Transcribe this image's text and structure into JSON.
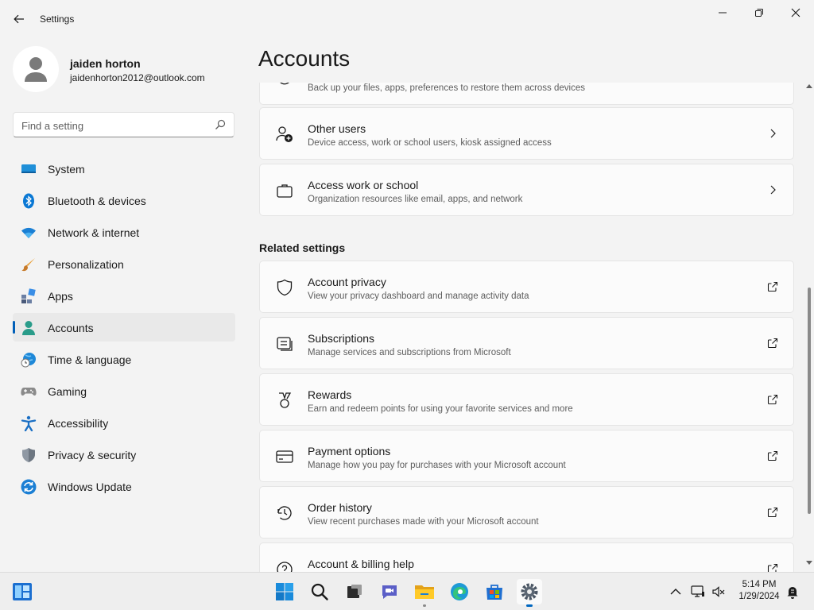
{
  "window": {
    "title": "Settings"
  },
  "profile": {
    "name": "jaiden horton",
    "email": "jaidenhorton2012@outlook.com"
  },
  "search": {
    "placeholder": "Find a setting"
  },
  "nav": {
    "items": [
      {
        "label": "System",
        "icon": "system-icon"
      },
      {
        "label": "Bluetooth & devices",
        "icon": "bluetooth-icon"
      },
      {
        "label": "Network & internet",
        "icon": "wifi-icon"
      },
      {
        "label": "Personalization",
        "icon": "brush-icon"
      },
      {
        "label": "Apps",
        "icon": "apps-icon"
      },
      {
        "label": "Accounts",
        "icon": "person-icon",
        "selected": true
      },
      {
        "label": "Time & language",
        "icon": "globe-clock-icon"
      },
      {
        "label": "Gaming",
        "icon": "gamepad-icon"
      },
      {
        "label": "Accessibility",
        "icon": "accessibility-icon"
      },
      {
        "label": "Privacy & security",
        "icon": "shield-icon"
      },
      {
        "label": "Windows Update",
        "icon": "update-icon"
      }
    ]
  },
  "main": {
    "title": "Accounts",
    "cards": [
      {
        "title": "",
        "subtitle": "Back up your files, apps, preferences to restore them across devices",
        "icon": "backup-icon",
        "action": "chevron-right-icon"
      },
      {
        "title": "Other users",
        "subtitle": "Device access, work or school users, kiosk assigned access",
        "icon": "person-add-icon",
        "action": "chevron-right-icon"
      },
      {
        "title": "Access work or school",
        "subtitle": "Organization resources like email, apps, and network",
        "icon": "briefcase-icon",
        "action": "chevron-right-icon"
      }
    ],
    "related_title": "Related settings",
    "related": [
      {
        "title": "Account privacy",
        "subtitle": "View your privacy dashboard and manage activity data",
        "icon": "shield-outline-icon",
        "action": "open-external-icon"
      },
      {
        "title": "Subscriptions",
        "subtitle": "Manage services and subscriptions from Microsoft",
        "icon": "subscriptions-icon",
        "action": "open-external-icon"
      },
      {
        "title": "Rewards",
        "subtitle": "Earn and redeem points for using your favorite services and more",
        "icon": "medal-icon",
        "action": "open-external-icon"
      },
      {
        "title": "Payment options",
        "subtitle": "Manage how you pay for purchases with your Microsoft account",
        "icon": "credit-card-icon",
        "action": "open-external-icon"
      },
      {
        "title": "Order history",
        "subtitle": "View recent purchases made with your Microsoft account",
        "icon": "history-icon",
        "action": "open-external-icon"
      },
      {
        "title": "Account & billing help",
        "subtitle": "",
        "icon": "help-icon",
        "action": "open-external-icon"
      }
    ]
  },
  "taskbar": {
    "apps": [
      "widgets-icon",
      "start-icon",
      "search-icon",
      "task-view-icon",
      "chat-icon",
      "file-explorer-icon",
      "edge-icon",
      "store-icon",
      "settings-icon"
    ],
    "tray": [
      "chevron-up-icon",
      "network-icon",
      "volume-muted-icon",
      "notifications-icon"
    ],
    "clock": {
      "time": "5:14 PM",
      "date": "1/29/2024"
    }
  },
  "colors": {
    "accent": "#005fb8",
    "background": "#f3f3f3",
    "card": "#fbfbfb"
  }
}
